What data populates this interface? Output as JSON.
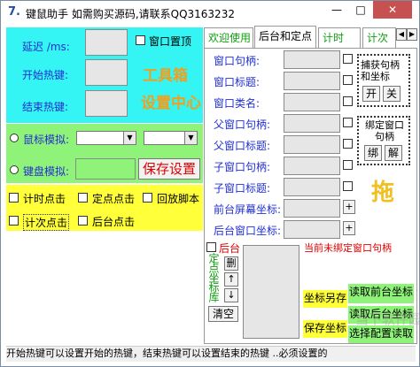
{
  "window": {
    "title": "键鼠助手   如需购买源码,请联系QQ3163232",
    "min_label": "—",
    "max_label": "□",
    "close_label": "✕"
  },
  "left": {
    "delay_label": "延迟 /ms:",
    "start_hotkey_label": "开始热键:",
    "end_hotkey_label": "结束热键:",
    "window_top_label": "窗口置顶",
    "toolbox_title": "工具箱",
    "settings_title": "设置中心",
    "mouse_sim_label": "鼠标模拟:",
    "keyboard_sim_label": "键盘模拟:",
    "save_settings_label": "保存设置",
    "options": [
      {
        "label": "计时点击"
      },
      {
        "label": "定点点击"
      },
      {
        "label": "回放脚本"
      },
      {
        "label": "计次点击"
      },
      {
        "label": "后台点击"
      }
    ]
  },
  "tabs": [
    {
      "label": "欢迎使用"
    },
    {
      "label": "后台和定点"
    },
    {
      "label": "计时"
    },
    {
      "label": "计次"
    }
  ],
  "tab_scroll": {
    "left": "◀",
    "right": "▶"
  },
  "fields": [
    {
      "label": "窗口句柄:"
    },
    {
      "label": "窗口标题:"
    },
    {
      "label": "窗口类名:"
    },
    {
      "label": "父窗口句柄:"
    },
    {
      "label": "父窗口标题:"
    },
    {
      "label": "子窗口句柄:"
    },
    {
      "label": "子窗口标题:"
    },
    {
      "label": "前台屏幕坐标:"
    },
    {
      "label": "后台窗口坐标:"
    }
  ],
  "capture": {
    "title": "捕获句柄和坐标",
    "open_label": "开",
    "close_label": "关"
  },
  "bind": {
    "title": "绑定窗口句柄",
    "bind_label": "绑",
    "unbind_label": "解"
  },
  "drag_label": "拖",
  "plus_label": "+",
  "background_label": "后台",
  "unbound_status": "当前未绑定窗口句柄",
  "coord_lib": {
    "vertical_label": "定点坐标库",
    "delete_label": "删",
    "up_label": "↑",
    "down_label": "↓",
    "clear_label": "清空"
  },
  "coord_buttons": {
    "save_as": "坐标另存",
    "save_coord": "保存坐标",
    "read_front": "读取前台坐标",
    "read_back": "读取后台坐标",
    "select_config": "选择配置读取"
  },
  "watermark": "当下软件园",
  "status_text": "开始热键可以设置开始的热键，结束热键可以设置结束的热键 ..必须设置的"
}
